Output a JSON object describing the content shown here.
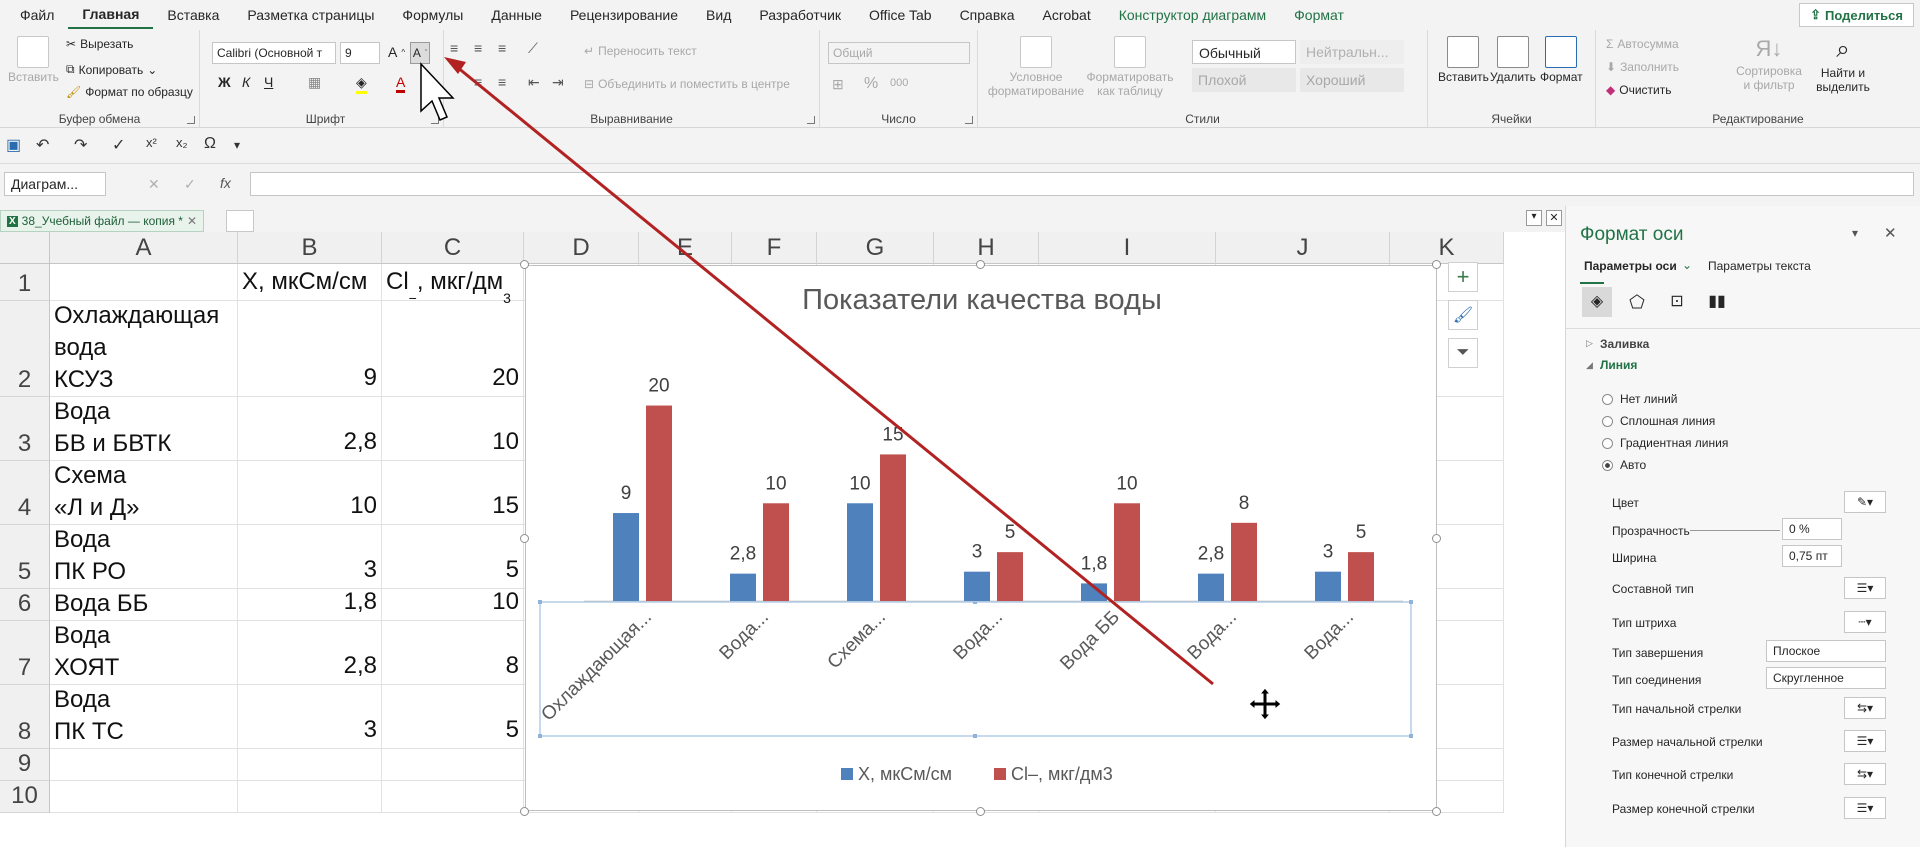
{
  "menu": {
    "items": [
      "Файл",
      "Главная",
      "Вставка",
      "Разметка страницы",
      "Формулы",
      "Данные",
      "Рецензирование",
      "Вид",
      "Разработчик",
      "Office Tab",
      "Справка",
      "Acrobat",
      "Конструктор диаграмм",
      "Формат"
    ],
    "active_index": 1,
    "contextual_from": 12,
    "share": "Поделиться"
  },
  "ribbon": {
    "clipboard": {
      "paste": "Вставить",
      "cut": "Вырезать",
      "copy": "Копировать",
      "format_painter": "Формат по образцу",
      "label": "Буфер обмена"
    },
    "font": {
      "name": "Calibri (Основной т",
      "size": "9",
      "bold": "Ж",
      "italic": "К",
      "underline": "Ч",
      "label": "Шрифт"
    },
    "alignment": {
      "wrap": "Переносить текст",
      "merge": "Объединить и поместить в центре",
      "label": "Выравнивание"
    },
    "number": {
      "format": "Общий",
      "label": "Число"
    },
    "styles": {
      "cond": "Условное форматирование",
      "table": "Форматировать как таблицу",
      "normal": "Обычный",
      "neutral": "Нейтральн...",
      "bad": "Плохой",
      "good": "Хороший",
      "label": "Стили"
    },
    "cells": {
      "insert": "Вставить",
      "delete": "Удалить",
      "format": "Формат",
      "label": "Ячейки"
    },
    "editing": {
      "autosum": "Автосумма",
      "fill": "Заполнить",
      "clear": "Очистить",
      "sort": "Сортировка и фильтр",
      "find": "Найти и выделить",
      "label": "Редактирование"
    }
  },
  "formula_bar": {
    "name_box": "Диаграм...",
    "fx": "fx",
    "value": ""
  },
  "tabs": {
    "file": "38_Учебный файл — копия *"
  },
  "columns": [
    "A",
    "B",
    "C",
    "D",
    "E",
    "F",
    "G",
    "H",
    "I",
    "J",
    "K"
  ],
  "rows": [
    "1",
    "2",
    "3",
    "4",
    "5",
    "6",
    "7",
    "8",
    "9",
    "10"
  ],
  "sheet": {
    "b1": "X, мкСм/см",
    "c1_main": "Cl",
    "c1_sup": "−",
    "c1_rest": ", мкг/дм",
    "c1_sup2": "3",
    "data": [
      {
        "a": "Охлаждающая\nвода\nКСУЗ",
        "b": "9",
        "c": "20"
      },
      {
        "a": "Вода\nБВ и БВТК",
        "b": "2,8",
        "c": "10"
      },
      {
        "a": "Схема\n«Л и Д»",
        "b": "10",
        "c": "15"
      },
      {
        "a": "Вода\nПК РО",
        "b": "3",
        "c": "5"
      },
      {
        "a": "Вода ББ",
        "b": "1,8",
        "c": "10"
      },
      {
        "a": "Вода\nХОЯТ",
        "b": "2,8",
        "c": "8"
      },
      {
        "a": "Вода\nПК ТС",
        "b": "3",
        "c": "5"
      }
    ]
  },
  "chart_data": {
    "type": "bar",
    "title": "Показатели качества воды",
    "categories": [
      "Охлаждающая...",
      "Вода...",
      "Схема...",
      "Вода...",
      "Вода ББ",
      "Вода...",
      "Вода..."
    ],
    "series": [
      {
        "name": "X, мкСм/см",
        "values": [
          9,
          2.8,
          10,
          3,
          1.8,
          2.8,
          3
        ],
        "labels": [
          "9",
          "2,8",
          "10",
          "3",
          "1,8",
          "2,8",
          "3"
        ],
        "color": "#4f81bd"
      },
      {
        "name": "Cl–, мкг/дм3",
        "values": [
          20,
          10,
          15,
          5,
          10,
          8,
          5
        ],
        "labels": [
          "20",
          "10",
          "15",
          "5",
          "10",
          "8",
          "5"
        ],
        "color": "#c0504d"
      }
    ],
    "ylim": [
      0,
      22
    ],
    "legend": "bottom",
    "grid": false
  },
  "pane": {
    "title": "Формат оси",
    "tab1": "Параметры оси",
    "tab2": "Параметры текста",
    "fill": "Заливка",
    "line": "Линия",
    "opts": [
      "Нет линий",
      "Сплошная линия",
      "Градиентная линия",
      "Авто"
    ],
    "color": "Цвет",
    "transparency": "Прозрачность",
    "transparency_val": "0 %",
    "width": "Ширина",
    "width_val": "0,75 пт",
    "compound": "Составной тип",
    "dash": "Тип штриха",
    "cap": "Тип завершения",
    "cap_val": "Плоское",
    "join": "Тип соединения",
    "join_val": "Скругленное",
    "begin_arrow": "Тип начальной стрелки",
    "begin_size": "Размер начальной стрелки",
    "end_arrow": "Тип конечной стрелки",
    "end_size": "Размер конечной стрелки"
  }
}
